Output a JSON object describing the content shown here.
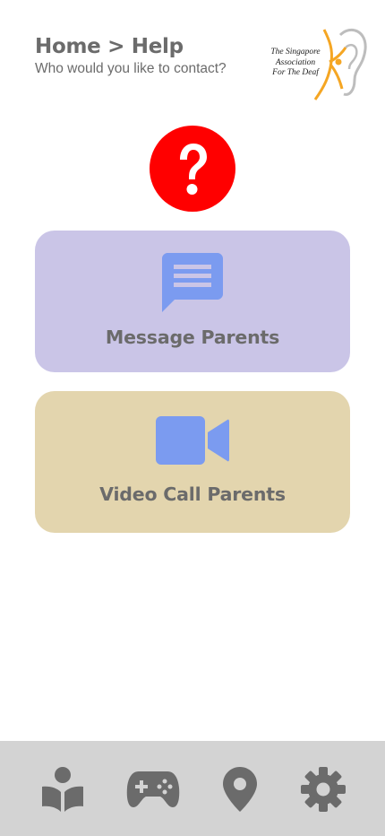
{
  "header": {
    "breadcrumb": "Home > Help",
    "subtitle": "Who would you like to contact?"
  },
  "logo": {
    "line1": "The Singapore",
    "line2": "Association",
    "line3": "For The Deaf",
    "colors": {
      "accent": "#f5a623",
      "ear": "#bdbdbd"
    }
  },
  "help": {
    "icon": "question-circle-icon",
    "color": "#ff0000"
  },
  "cards": [
    {
      "label": "Message Parents",
      "icon": "message-icon",
      "background": "#cac5e7",
      "icon_color": "#7b9bf0"
    },
    {
      "label": "Video Call Parents",
      "icon": "video-camera-icon",
      "background": "#e3d5ae",
      "icon_color": "#7b9bf0"
    }
  ],
  "bottom_nav": {
    "items": [
      {
        "name": "learn",
        "icon": "reader-book-icon"
      },
      {
        "name": "games",
        "icon": "gamepad-icon"
      },
      {
        "name": "location",
        "icon": "map-pin-icon"
      },
      {
        "name": "settings",
        "icon": "gear-icon"
      }
    ],
    "background": "#d3d3d3",
    "icon_color": "#6b6b6b"
  }
}
